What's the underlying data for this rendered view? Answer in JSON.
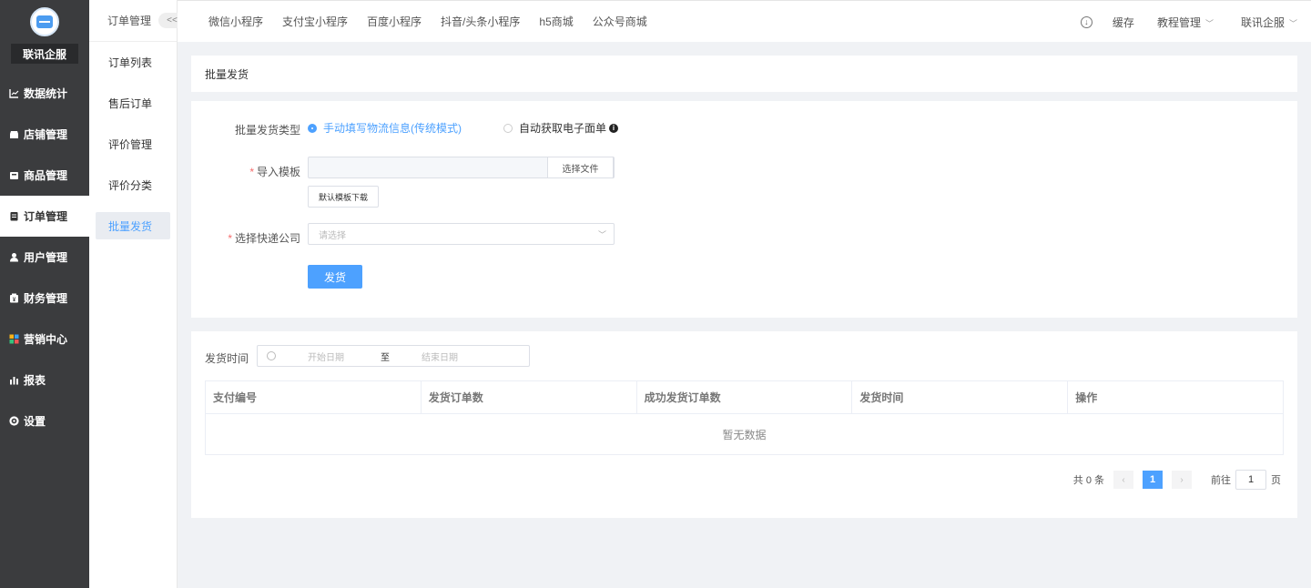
{
  "sidebar": {
    "brand": "联讯企服",
    "items": [
      {
        "label": "数据统计",
        "icon": "chart-icon"
      },
      {
        "label": "店铺管理",
        "icon": "store-icon"
      },
      {
        "label": "商品管理",
        "icon": "box-icon"
      },
      {
        "label": "订单管理",
        "icon": "order-icon",
        "active": true
      },
      {
        "label": "用户管理",
        "icon": "user-icon"
      },
      {
        "label": "财务管理",
        "icon": "finance-icon"
      },
      {
        "label": "营销中心",
        "icon": "marketing-icon"
      },
      {
        "label": "报表",
        "icon": "report-icon"
      },
      {
        "label": "设置",
        "icon": "gear-icon"
      }
    ]
  },
  "subnav": {
    "title": "订单管理",
    "collapse": "<<",
    "items": [
      "订单列表",
      "售后订单",
      "评价管理",
      "评价分类",
      "批量发货"
    ]
  },
  "topbar": {
    "tabs": [
      "微信小程序",
      "支付宝小程序",
      "百度小程序",
      "抖音/头条小程序",
      "h5商城",
      "公众号商城"
    ],
    "cache": "缓存",
    "tutorial": "教程管理",
    "account": "联讯企服"
  },
  "page": {
    "title": "批量发货"
  },
  "form": {
    "type_label": "批量发货类型",
    "option_manual": "手动填写物流信息(传统模式)",
    "option_auto": "自动获取电子面单",
    "import_label": "导入模板",
    "choose_file": "选择文件",
    "download_template": "默认模板下载",
    "courier_label": "选择快递公司",
    "courier_placeholder": "请选择",
    "submit": "发货",
    "required_mark": "*"
  },
  "records": {
    "date_label": "发货时间",
    "start_placeholder": "开始日期",
    "to": "至",
    "end_placeholder": "结束日期",
    "columns": [
      "支付编号",
      "发货订单数",
      "成功发货订单数",
      "发货时间",
      "操作"
    ],
    "empty": "暂无数据"
  },
  "pagination": {
    "total": "共 0 条",
    "current": "1",
    "goto_prefix": "前往",
    "goto_value": "1",
    "goto_suffix": "页"
  }
}
